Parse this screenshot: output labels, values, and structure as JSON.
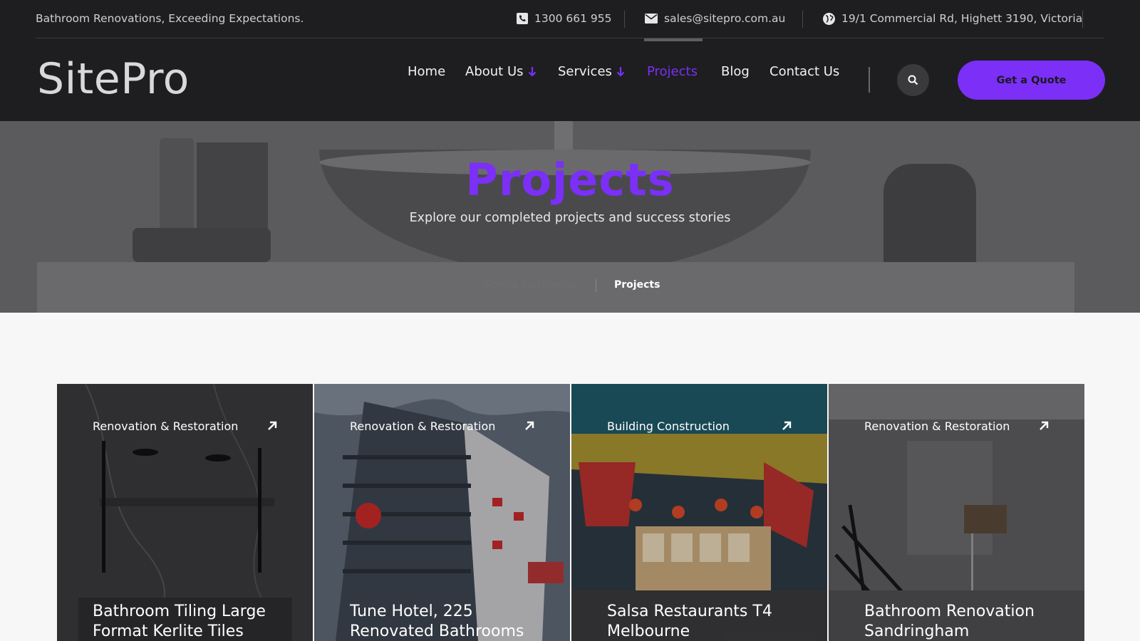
{
  "topbar": {
    "tagline": "Bathroom Renovations, Exceeding Expectations.",
    "phone": "1300 661 955",
    "email": "sales@sitepro.com.au",
    "address": "19/1 Commercial Rd, Highett 3190, Victoria"
  },
  "header": {
    "logo": "SitePro",
    "nav": [
      {
        "label": "Home"
      },
      {
        "label": "About Us"
      },
      {
        "label": "Services"
      },
      {
        "label": "Projects"
      },
      {
        "label": "Blog"
      },
      {
        "label": "Contact Us"
      }
    ],
    "cta_label": "Get a Quote"
  },
  "hero": {
    "title": "Projects",
    "subtitle": "Explore our completed projects and success stories",
    "breadcrumb": [
      "SitePro Bathrooms",
      "Projects"
    ]
  },
  "projects": [
    {
      "category": "Renovation & Restoration",
      "title": "Bathroom Tiling Large Format Kerlite Tiles"
    },
    {
      "category": "Renovation & Restoration",
      "title": "Tune Hotel, 225 Renovated Bathrooms"
    },
    {
      "category": "Building Construction",
      "title": "Salsa Restaurants T4 Melbourne"
    },
    {
      "category": "Renovation & Restoration",
      "title": "Bathroom Renovation Sandringham"
    }
  ],
  "colors": {
    "accent": "#7b2ff7",
    "dark_bg": "#1e1e20"
  }
}
